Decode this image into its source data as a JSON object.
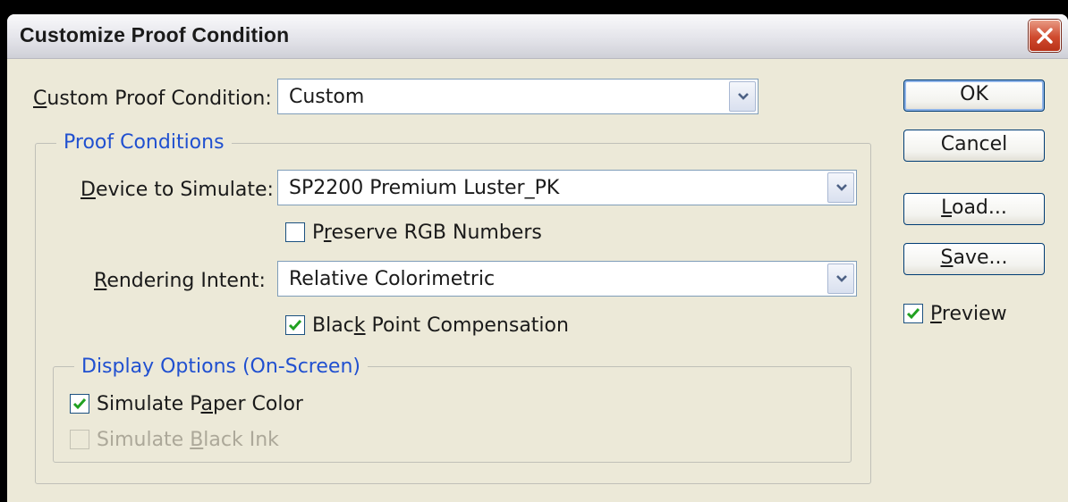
{
  "window": {
    "title": "Customize Proof Condition"
  },
  "custom_condition": {
    "label": "Custom Proof Condition:",
    "value": "Custom"
  },
  "proof_conditions": {
    "legend": "Proof Conditions",
    "device": {
      "label": "Device to Simulate:",
      "value": "SP2200 Premium Luster_PK"
    },
    "preserve_rgb": {
      "label": "Preserve RGB Numbers",
      "checked": false
    },
    "rendering": {
      "label": "Rendering Intent:",
      "value": "Relative Colorimetric"
    },
    "black_point": {
      "label": "Black Point Compensation",
      "checked": true
    }
  },
  "display_options": {
    "legend": "Display Options (On-Screen)",
    "paper_color": {
      "label": "Simulate Paper Color",
      "checked": true
    },
    "black_ink": {
      "label": "Simulate Black Ink",
      "checked": false,
      "disabled": true
    }
  },
  "buttons": {
    "ok": "OK",
    "cancel": "Cancel",
    "load": "Load...",
    "save": "Save..."
  },
  "preview": {
    "label": "Preview",
    "checked": true
  },
  "colors": {
    "legend_text": "#2050d0",
    "checkmark": "#21a121"
  }
}
